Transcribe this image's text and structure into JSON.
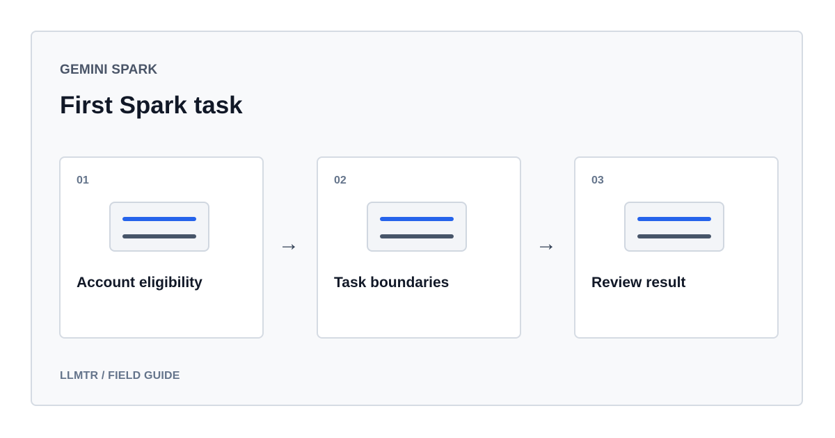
{
  "header": {
    "eyebrow": "GEMINI SPARK",
    "title": "First Spark task"
  },
  "steps": [
    {
      "number": "01",
      "label": "Account eligibility"
    },
    {
      "number": "02",
      "label": "Task boundaries"
    },
    {
      "number": "03",
      "label": "Review result"
    }
  ],
  "connectors": [
    "→",
    "→"
  ],
  "footer": {
    "text": "LLMTR / FIELD GUIDE"
  },
  "colors": {
    "accent": "#2563eb",
    "secondary_bar": "#475569",
    "border": "#d5dbe3",
    "panel_bg": "#f8f9fb"
  },
  "icons": [
    "document-lines-icon",
    "arrow-right-icon"
  ]
}
